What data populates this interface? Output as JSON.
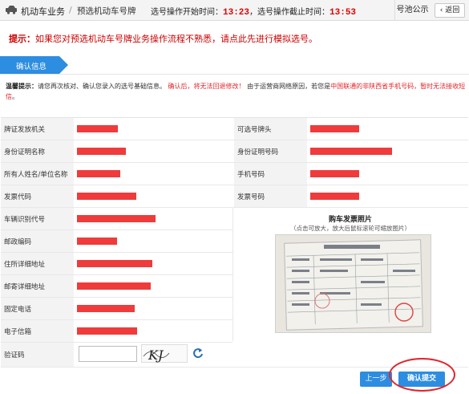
{
  "header": {
    "app_title": "机动车业务",
    "separator": "/",
    "page_title": "预选机动车号牌",
    "start_label": "选号操作开始时间：",
    "start_time": "13:23",
    "mid_sep": "，",
    "end_label": "选号操作截止时间：",
    "end_time": "13:53",
    "pool_label": "号池公示",
    "back_label": "返回",
    "car_icon": "car-icon",
    "back_icon": "chevron-left-icon"
  },
  "tip": {
    "prefix": "提示：",
    "text": "如果您对预选机动车号牌业务操作流程不熟悉，请点此先进行模拟选号。"
  },
  "step": {
    "label": "确认信息"
  },
  "reminder": {
    "label": "温馨提示：",
    "text1": "请您再次核对、确认您录入的选号基础信息。",
    "red1": "确认后，将无法回退修改！",
    "text2": "由于运营商网络原因，若您是",
    "red2": "中国联通的非陕西省手机号码，暂时无法接收短信",
    "end": "。"
  },
  "form": {
    "left_labels": [
      "牌证发放机关",
      "身份证明名称",
      "所有人姓名/单位名称",
      "发票代码",
      "车辆识别代号",
      "邮政编码",
      "住所详细地址",
      "邮寄详细地址",
      "固定电话",
      "电子信箱"
    ],
    "right_labels": [
      "可选号牌头",
      "身份证明号码",
      "手机号码",
      "发票号码"
    ],
    "redacted_left": [
      0.52,
      0.62,
      0.55,
      0.76,
      1.0,
      0.51,
      0.96,
      0.94,
      0.73,
      0.77
    ],
    "redacted_right": [
      0.6,
      1.0,
      0.6,
      0.6
    ],
    "photo_title": "购车发票照片",
    "photo_subtitle": "（点击可放大，放大后鼠标滚轮可缩放图片）",
    "captcha_label": "验证码",
    "captcha_text": "KJ",
    "captcha_input_value": "",
    "refresh_icon": "refresh-icon"
  },
  "buttons": {
    "prev": "上一步",
    "submit": "确认提交"
  },
  "colors": {
    "accent": "#2d8de0",
    "red": "#e0252b",
    "redact": "#ef3b3b"
  }
}
